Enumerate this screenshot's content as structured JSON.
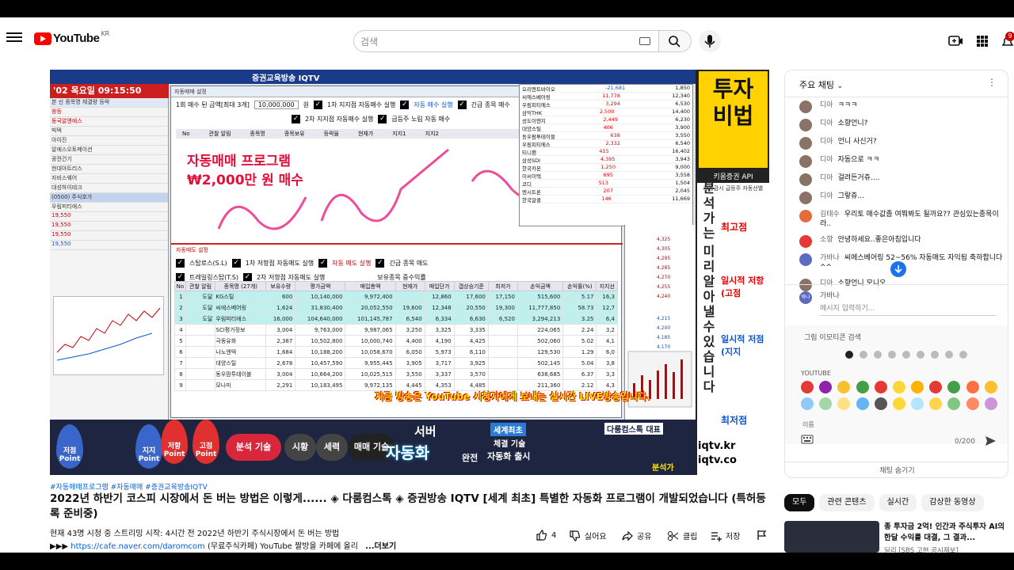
{
  "header": {
    "logo_text": "YouTube",
    "logo_region": "KR",
    "search_placeholder": "검색",
    "notification_count": "9"
  },
  "video": {
    "time_bar": "'02 목요일 09:15:50",
    "channel_title": "증권교육방송 IQTV",
    "window_title": "자동매매 설정",
    "pink_title_1": "자동매매 프로그램",
    "pink_title_2": "₩2,000만 원 매수",
    "buy_amount_label": "1회 매수 된 금액[최대 3개]",
    "buy_amount_value": "10,000,000",
    "buy_amount_unit": "원",
    "setting_1": "1차 지지점 자동매수 실행",
    "setting_2": "자동 매수 실행",
    "setting_3": "긴급 종목 매수",
    "setting_4": "2차 지지점 자동매수 실행",
    "setting_5": "급등주 노림 자동 매수",
    "sell_title": "자동매도 설정",
    "sell_opt_1": "스탑로스(S.L)",
    "sell_opt_2": "1차 저항점 자동매도 실행",
    "sell_opt_3": "자동 매도 실행",
    "sell_opt_4": "긴급 종목 매도",
    "sell_opt_5": "트레일링스탑(T.S)",
    "sell_opt_6": "2차 저항점 자동매도 실행",
    "sell_opt_7": "보유종목 중수익률",
    "table_headers": [
      "No",
      "",
      "관찰 알림",
      "종목명 (27개)",
      "보유수량",
      "평가금액",
      "매입총액",
      "현재가",
      "매입단가",
      "갭상승기준",
      "최저가",
      "손익금액",
      "손익률(%)",
      "지지선"
    ],
    "rows": [
      [
        "1",
        "도달",
        "KG스틸",
        "600",
        "10,140,000",
        "9,972,400",
        "",
        "12,860",
        "17,600",
        "17,150",
        "515,600",
        "5.17",
        "16,3"
      ],
      [
        "2",
        "도달",
        "씨에스베어링",
        "1,624",
        "31,830,400",
        "20,052,550",
        "19,600",
        "12,348",
        "20,550",
        "19,300",
        "11,777,850",
        "58.73",
        "12,7"
      ],
      [
        "3",
        "도달",
        "우림피티에스",
        "16,000",
        "104,640,000",
        "101,145,787",
        "6,540",
        "6,334",
        "6,630",
        "6,520",
        "3,294,213",
        "3.25",
        "6,4"
      ],
      [
        "4",
        "",
        "SCI평가정보",
        "3,004",
        "9,763,000",
        "9,987,065",
        "3,250",
        "3,325",
        "3,335",
        "",
        "224,065",
        "2.24",
        "3,2"
      ],
      [
        "5",
        "",
        "극동유화",
        "2,387",
        "10,502,800",
        "10,000,740",
        "4,400",
        "4,190",
        "4,425",
        "",
        "502,060",
        "5.02",
        "4,1"
      ],
      [
        "6",
        "",
        "나노엔텍",
        "1,684",
        "10,188,200",
        "10,058,670",
        "6,050",
        "5,973",
        "6,110",
        "",
        "129,530",
        "1.29",
        "6,0"
      ],
      [
        "7",
        "",
        "대양스틸",
        "2,678",
        "10,457,590",
        "9,955,445",
        "3,905",
        "3,717",
        "3,925",
        "",
        "502,145",
        "5.04",
        "3,8"
      ],
      [
        "8",
        "",
        "동우팜투테이블",
        "3,004",
        "10,664,200",
        "10,025,515",
        "3,550",
        "3,337",
        "3,570",
        "",
        "638,685",
        "6.37",
        "3,3"
      ],
      [
        "9",
        "",
        "모나미",
        "2,291",
        "10,183,495",
        "9,972,135",
        "4,445",
        "4,353",
        "4,485",
        "",
        "211,360",
        "2.12",
        "4,3"
      ]
    ],
    "bottom_caption": "지금 방송은 YouTube 시청자에게 보내는 실시간 LIVE방송입니다.",
    "right_window_rows": [
      [
        "오리엔트바이오",
        "-21,681",
        "1,850"
      ],
      [
        "씨에스베어링",
        "11,778",
        "12,340"
      ],
      [
        "우림피티에스",
        "3,294",
        "6,530"
      ],
      [
        "삼익THK",
        "2,500",
        "14,400"
      ],
      [
        "성도이엔지",
        "2,449",
        "6,230"
      ],
      [
        "대양스틸",
        "406",
        "3,900"
      ],
      [
        "동우팜투테이블",
        "638",
        "3,550"
      ],
      [
        "우림피티에스",
        "2,332",
        "6,540"
      ],
      [
        "티니펜",
        "415",
        "16,402"
      ],
      [
        "삼성SDI",
        "4,395",
        "3,943"
      ],
      [
        "한국카본",
        "1,250",
        "9,000"
      ],
      [
        "이씨이텍",
        "695",
        "3,558"
      ],
      [
        "코디",
        "513",
        "1,504"
      ],
      [
        "엔시트론",
        "207",
        "2,045"
      ],
      [
        "한국알콜",
        "146",
        "11,669"
      ]
    ],
    "side_banner": {
      "title_1": "투자",
      "title_2": "비법",
      "subtitle": "키움증권 API",
      "sub2": "자동감시 급등주 자동선별",
      "vertical_1": "분석가는",
      "vertical_2": "미리 알아낼 수 있습니다",
      "item_1": "최고점",
      "item_2": "일시적 저항(고점",
      "item_3": "일시적 저점(지지",
      "item_4": "최저점"
    },
    "bottom_banner": {
      "drop_1": "저점 Point",
      "drop_2": "지지 Point",
      "drop_3": "저항 Point",
      "drop_4": "고점 Point",
      "pill_1": "분석 기술",
      "pill_2": "시황",
      "pill_3": "세력",
      "pill_4": "매매 기술",
      "server": "서버",
      "automation": "자동화",
      "complete": "완전",
      "world_first": "세계최초",
      "tech": "체결 기술",
      "auto_launch": "자동화 출시",
      "darum": "다룸컴스톡 대표",
      "analyst": "분석가",
      "iqtv_1": "iqtv.kr",
      "iqtv_2": "iqtv.co"
    }
  },
  "info": {
    "hashtags": "#자동매매프로그램 #자동매매 #증권교육방송IQTV",
    "title": "2022년 하반기 코스피 시장에서 돈 버는 방법은 이렇게...... ◈ 다룸컴스톡 ◈ 증권방송 IQTV [세계 최초] 특별한 자동화 프로그램이 개발되었습니다 (특허등록 준비중)",
    "meta_line": "현재 43명 시청 중  스트리밍 시작: 4시간 전  2022년 하반기 주식시장에서 돈 버는 방법",
    "meta_prefix": "▶▶▶ ",
    "meta_link": "https://cafe.naver.com/daromcom",
    "meta_suffix": " (무료주식카페) YouTube 짤방을 카페에  올리",
    "more": "...더보기",
    "like_count": "4",
    "dislike": "싫어요",
    "share": "공유",
    "clip": "클립",
    "save": "저장"
  },
  "chat": {
    "header": "주요 채팅",
    "messages": [
      {
        "name": "디아",
        "text": "ㅋㅋㅋ",
        "color": "#8b7266"
      },
      {
        "name": "디아",
        "text": "소향언니?",
        "color": "#8b7266"
      },
      {
        "name": "디아",
        "text": "언니 사신거?",
        "color": "#8b7266"
      },
      {
        "name": "디아",
        "text": "자동으로 ㅋㅋ",
        "color": "#8b7266"
      },
      {
        "name": "디아",
        "text": "걸려든거쥬....",
        "color": "#8b7266"
      },
      {
        "name": "디아",
        "text": "그랗쥬...",
        "color": "#8b7266"
      },
      {
        "name": "김태수",
        "text": "우리토 매수값좀 여쭤봐도 될까요?? 관심있는종목이라..",
        "color": "#e56b3a"
      },
      {
        "name": "소향",
        "text": "안녕하세요..좋은아침입니다",
        "color": "#e53935"
      },
      {
        "name": "가바나",
        "text": "씨에스베어링 52~56% 자동매도 자익됨 축하합니다^^",
        "color": "#5c6bc0"
      },
      {
        "name": "디아",
        "text": "소향언니 모니오",
        "color": "#8b7266"
      }
    ],
    "composer_name": "가바나",
    "composer_placeholder": "메시지 입력하기...",
    "emoji_search": "그림 이모티콘 검색",
    "emoji_section": "YOUTUBE",
    "name_label": "이름",
    "char_count": "0/200",
    "hide_chat": "채팅 숨기기"
  },
  "chips": [
    "모두",
    "관련 콘텐츠",
    "실시간",
    "감상한 동영상"
  ],
  "recommendation": {
    "title": "종 투자금 2억! 인간과 주식투자 AI의 한달 수익률 대결, 그 결과...",
    "channel": "딜리 [SBS 고현 공시재보]"
  }
}
